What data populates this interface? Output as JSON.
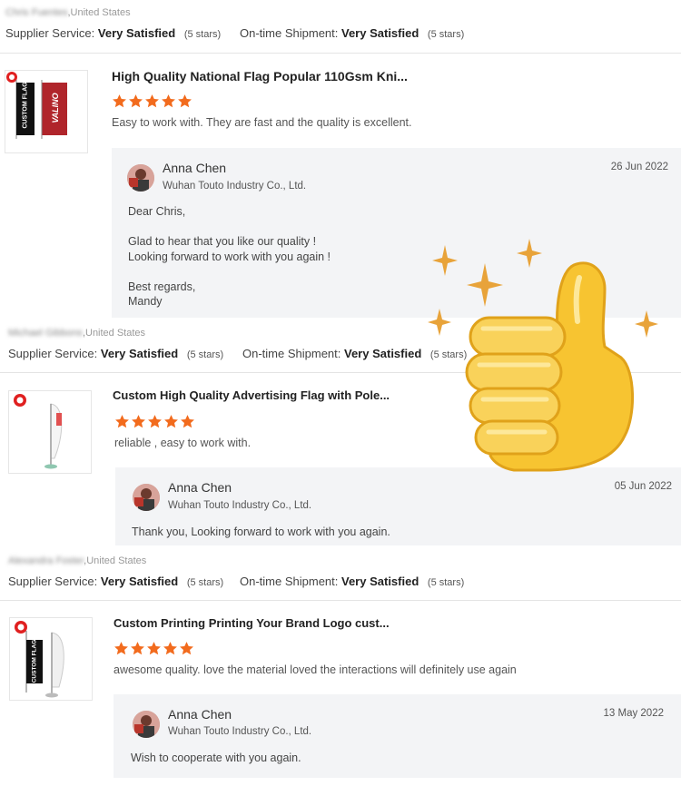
{
  "reviews": [
    {
      "reviewer_blurred": "Chris Fuentes",
      "country": ",United States",
      "supplier_label": "Supplier Service:",
      "supplier_value": "Very Satisfied",
      "supplier_stars": "(5 stars)",
      "shipment_label": "On-time Shipment:",
      "shipment_value": "Very Satisfied",
      "shipment_stars": "(5 stars)"
    },
    {
      "reviewer_blurred": "Michael Gibbons",
      "country": ",United States",
      "supplier_label": "Supplier Service:",
      "supplier_value": "Very Satisfied",
      "supplier_stars": "(5 stars)",
      "shipment_label": "On-time Shipment:",
      "shipment_value": "Very Satisfied",
      "shipment_stars": "(5 stars)"
    },
    {
      "reviewer_blurred": "Alexandra Foster",
      "country": ",United States",
      "supplier_label": "Supplier Service:",
      "supplier_value": "Very Satisfied",
      "supplier_stars": "(5 stars)",
      "shipment_label": "On-time Shipment:",
      "shipment_value": "Very Satisfied",
      "shipment_stars": "(5 stars)"
    }
  ],
  "products": [
    {
      "title": "High Quality National Flag Popular 110Gsm Kni...",
      "rating": 5,
      "comment": "Easy to work with. They are fast and the quality is excellent.",
      "thumb_text_1": "CUSTOM FLAG",
      "thumb_text_2": "VALINO",
      "reply": {
        "name": "Anna Chen",
        "company": "Wuhan Touto Industry Co., Ltd.",
        "date": "26 Jun 2022",
        "text": "Dear Chris,\n\nGlad to hear that you like our quality !\nLooking forward to work with you again !\n\nBest regards,\nMandy"
      }
    },
    {
      "title": "Custom High Quality Advertising Flag with Pole...",
      "rating": 5,
      "comment": "reliable , easy to work with.",
      "reply": {
        "name": "Anna Chen",
        "company": "Wuhan Touto Industry Co., Ltd.",
        "date": "05 Jun 2022",
        "text": "Thank you, Looking forward to work with you again."
      }
    },
    {
      "title": "Custom Printing Printing Your Brand Logo cust...",
      "rating": 5,
      "comment": "awesome quality. love the material loved the interactions will definitely use again",
      "thumb_text_1": "CUSTOM FLAG",
      "reply": {
        "name": "Anna Chen",
        "company": "Wuhan Touto Industry Co., Ltd.",
        "date": "13 May 2022",
        "text": "Wish to cooperate with you again."
      }
    }
  ],
  "colors": {
    "star": "#f26b1d",
    "thumbs_up": "#f7c431",
    "sparkle": "#e8a33a"
  },
  "icons": {
    "star": "star-icon",
    "overlay": "thumbs-up-icon",
    "sparkle": "sparkle-icon"
  }
}
